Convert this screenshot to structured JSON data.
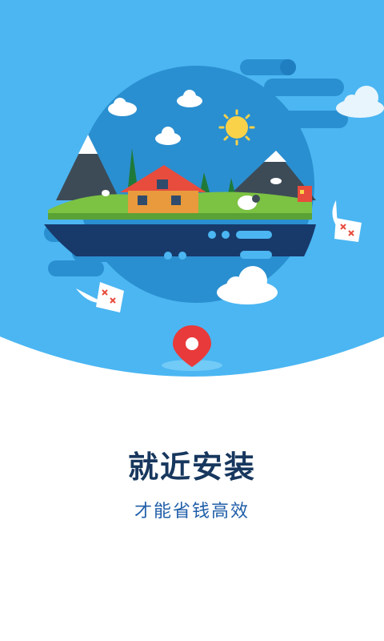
{
  "splash": {
    "headline": "就近安装",
    "subline": "才能省钱高效"
  },
  "colors": {
    "sky": "#4bb6f2",
    "globe": "#2a8fd0",
    "headline": "#17375e",
    "subline": "#1f5ea8",
    "pin": "#e83a3a",
    "sun": "#f9d24a"
  },
  "icons": [
    "location-pin-icon",
    "sun-icon",
    "cloud-icon",
    "paper-map-icon"
  ]
}
